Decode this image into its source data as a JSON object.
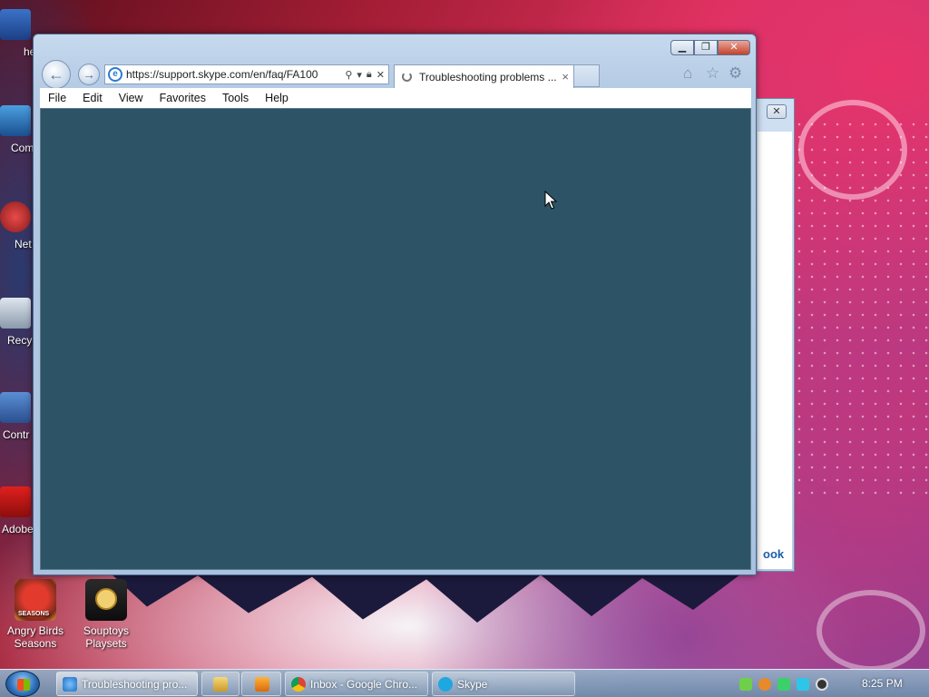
{
  "desktop": {
    "icons": [
      {
        "label_line1": "Angry Birds",
        "label_line2": "Seasons",
        "badge": "SEASONS"
      },
      {
        "label_line1": "Souptoys",
        "label_line2": "Playsets"
      }
    ],
    "partial_icons": [
      "he",
      "Com",
      "Net",
      "Recy",
      "Contr",
      "Adobe"
    ]
  },
  "background_dialog": {
    "link_text": "ook",
    "close_glyph": "✕"
  },
  "browser": {
    "address_url": "https://support.skype.com/en/faq/FA100",
    "tab_title": "Troubleshooting problems ...",
    "tab_close": "×",
    "menu": [
      "File",
      "Edit",
      "View",
      "Favorites",
      "Tools",
      "Help"
    ],
    "caption": {
      "minimize": "▁",
      "maximize": "❐",
      "close": "✕"
    },
    "content_color": "#2d5366"
  },
  "taskbar": {
    "items": [
      {
        "label": "Troubleshooting pro...",
        "icon": "ie-icon",
        "active": true
      },
      {
        "label": "",
        "icon": "explorer-icon"
      },
      {
        "label": "",
        "icon": "media-player-icon"
      },
      {
        "label": "Inbox - Google Chro...",
        "icon": "chrome-icon"
      },
      {
        "label": "Skype",
        "icon": "skype-icon"
      }
    ],
    "clock": "8:25 PM"
  }
}
